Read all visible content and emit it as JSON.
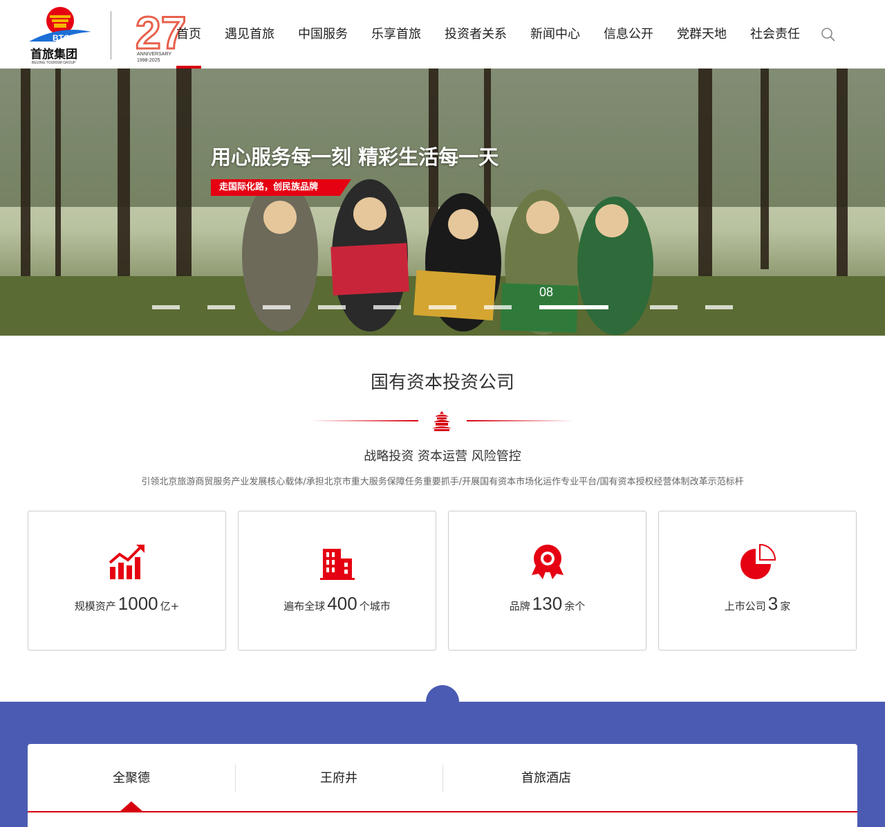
{
  "header": {
    "logo_name": "首旅集团",
    "logo_sub": "BEIJING TOURISM GROUP",
    "logo_badge": "BTG",
    "anniversary_number": "27",
    "anniversary_label": "ANNIVERSARY",
    "anniversary_years": "1998-2025",
    "nav": [
      "首页",
      "遇见首旅",
      "中国服务",
      "乐享首旅",
      "投资者关系",
      "新闻中心",
      "信息公开",
      "党群天地",
      "社会责任"
    ],
    "active_nav": "首页"
  },
  "banner": {
    "headline": "用心服务每一刻 精彩生活每一天",
    "tag": "走国际化路，创民族品牌",
    "slide_number": "08",
    "slide_count": 11,
    "active_slide": 8,
    "accent_color": "#e50012"
  },
  "intro": {
    "title": "国有资本投资公司",
    "subtitle": "战略投资 资本运营 风险管控",
    "description": "引领北京旅游商贸服务产业发展核心载体/承担北京市重大服务保障任务重要抓手/开展国有资本市场化运作专业平台/国有资本授权经营体制改革示范标杆"
  },
  "stats": [
    {
      "icon": "growth-chart-icon",
      "prefix": "规模资产",
      "value": "1000",
      "suffix": "亿+"
    },
    {
      "icon": "building-icon",
      "prefix": "遍布全球",
      "value": "400",
      "suffix": "个城市"
    },
    {
      "icon": "award-ribbon-icon",
      "prefix": "品牌",
      "value": "130",
      "suffix": "余个"
    },
    {
      "icon": "pie-chart-icon",
      "prefix": "上市公司",
      "value": "3",
      "suffix": "家"
    }
  ],
  "brands": {
    "tabs": [
      "全聚德",
      "王府井",
      "首旅酒店"
    ],
    "active_tab": "全聚德",
    "background_color": "#4b5bb3"
  }
}
